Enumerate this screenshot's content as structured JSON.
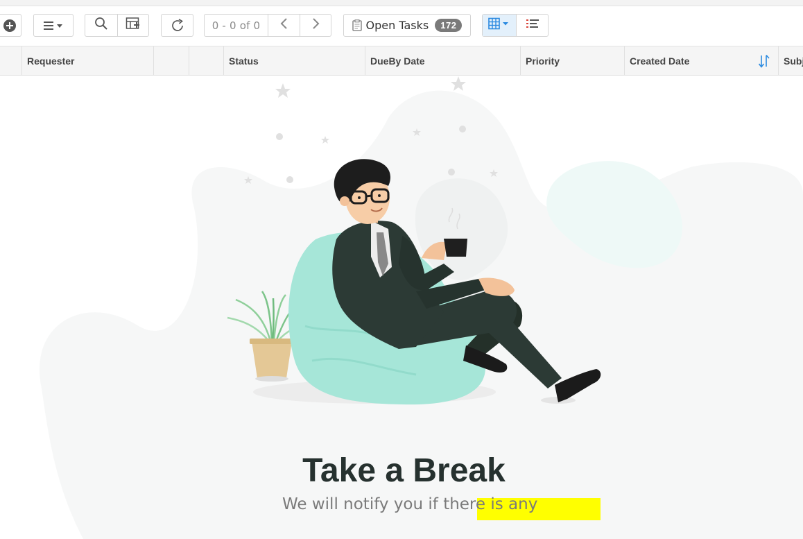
{
  "toolbar": {
    "add_icon": "plus-circle-icon",
    "menu_icon": "hamburger-menu-icon",
    "search_icon": "search-icon",
    "column_icon": "add-column-icon",
    "refresh_icon": "refresh-icon",
    "pager_text": "0 - 0 of 0",
    "prev_icon": "chevron-left-icon",
    "next_icon": "chevron-right-icon",
    "open_tasks_label": "Open Tasks",
    "open_tasks_count": "172",
    "grid_view_icon": "grid-view-icon",
    "list_view_icon": "list-view-icon"
  },
  "columns": {
    "requester": "Requester",
    "status": "Status",
    "dueby": "DueBy Date",
    "priority": "Priority",
    "created": "Created Date",
    "subject": "Subj"
  },
  "empty_state": {
    "title": "Take a Break",
    "subtitle": "We will notify you if there is any"
  },
  "colors": {
    "accent": "#2b8ae0",
    "beanbag": "#a6e6d8",
    "suit": "#2c3a35",
    "highlight": "#ffff00"
  }
}
